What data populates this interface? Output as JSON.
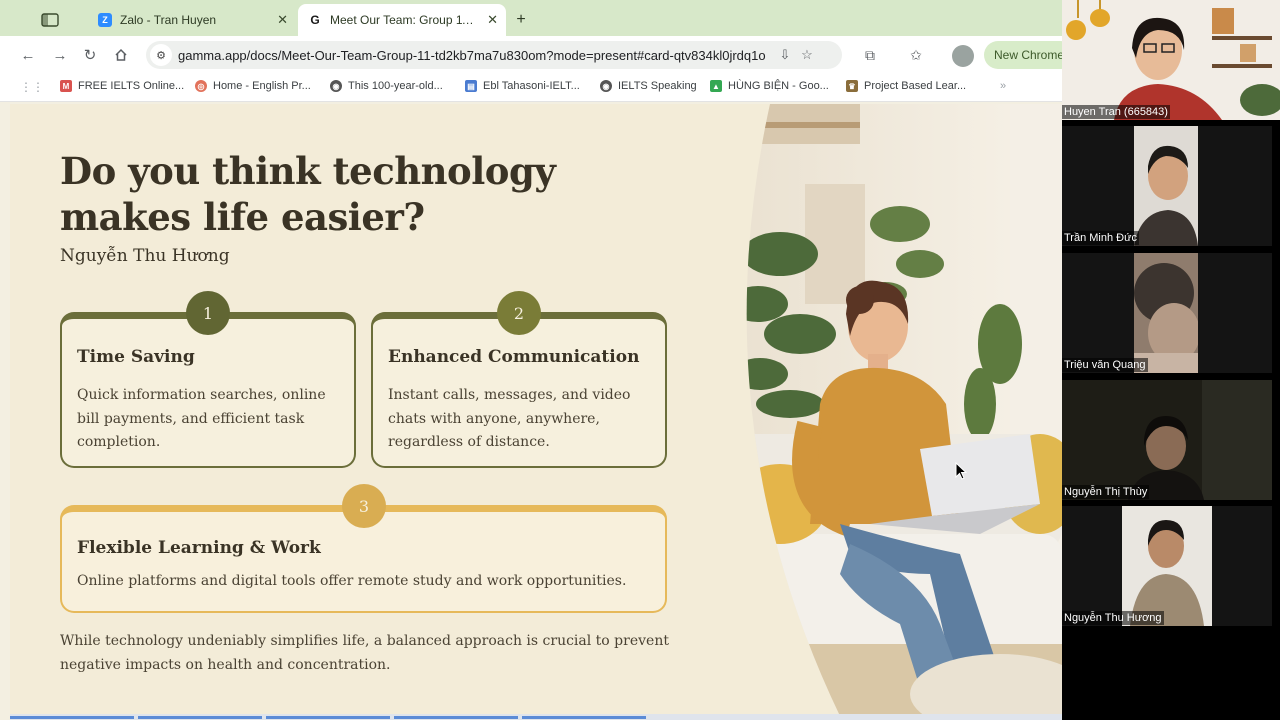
{
  "browser": {
    "tabs": [
      {
        "label": "Zalo - Tran Huyen",
        "favicon": "zalo-icon"
      },
      {
        "label": "Meet Our Team: Group 11 | Ga",
        "favicon": "gamma-icon",
        "active": true
      }
    ],
    "url": "gamma.app/docs/Meet-Our-Team-Group-11-td2kb7ma7u830om?mode=present#card-qtv834kl0jrdq1o",
    "new_chrome_label": "New Chrome",
    "bookmarks": [
      {
        "label": "FREE IELTS Online...",
        "color": "#d9534f"
      },
      {
        "label": "Home - English Pr...",
        "color": "#e2725b"
      },
      {
        "label": "This 100-year-old...",
        "color": "#555555"
      },
      {
        "label": "Ebl Tahasoni-IELT...",
        "color": "#4a7bd0"
      },
      {
        "label": "IELTS Speaking",
        "color": "#555555"
      },
      {
        "label": "HÙNG BIỆN - Goo...",
        "color": "#34a853"
      },
      {
        "label": "Project Based Lear...",
        "color": "#8a6d3b"
      }
    ]
  },
  "slide": {
    "heading": "Do you think technology makes life easier?",
    "author": "Nguyễn Thu Hương",
    "cards": [
      {
        "number": "1",
        "title": "Time Saving",
        "body": "Quick information searches, online bill payments, and efficient task completion."
      },
      {
        "number": "2",
        "title": "Enhanced Communication",
        "body": "Instant calls, messages, and video chats with anyone, anywhere, regardless of distance."
      },
      {
        "number": "3",
        "title": "Flexible Learning & Work",
        "body": "Online platforms and digital tools offer remote study and work opportunities."
      }
    ],
    "conclusion": "While technology undeniably simplifies life, a balanced approach is crucial to prevent negative impacts on health and concentration.",
    "colors": {
      "olive": "#6b6e3a",
      "gold": "#e6b95a",
      "background": "#f3ecd8"
    }
  },
  "participants": [
    {
      "name": "Huyen Tran (665843)"
    },
    {
      "name": "Trần Minh Đức"
    },
    {
      "name": "Triệu văn Quang"
    },
    {
      "name": "Nguyễn Thị Thùy"
    },
    {
      "name": "Nguyễn Thu Hương"
    }
  ]
}
